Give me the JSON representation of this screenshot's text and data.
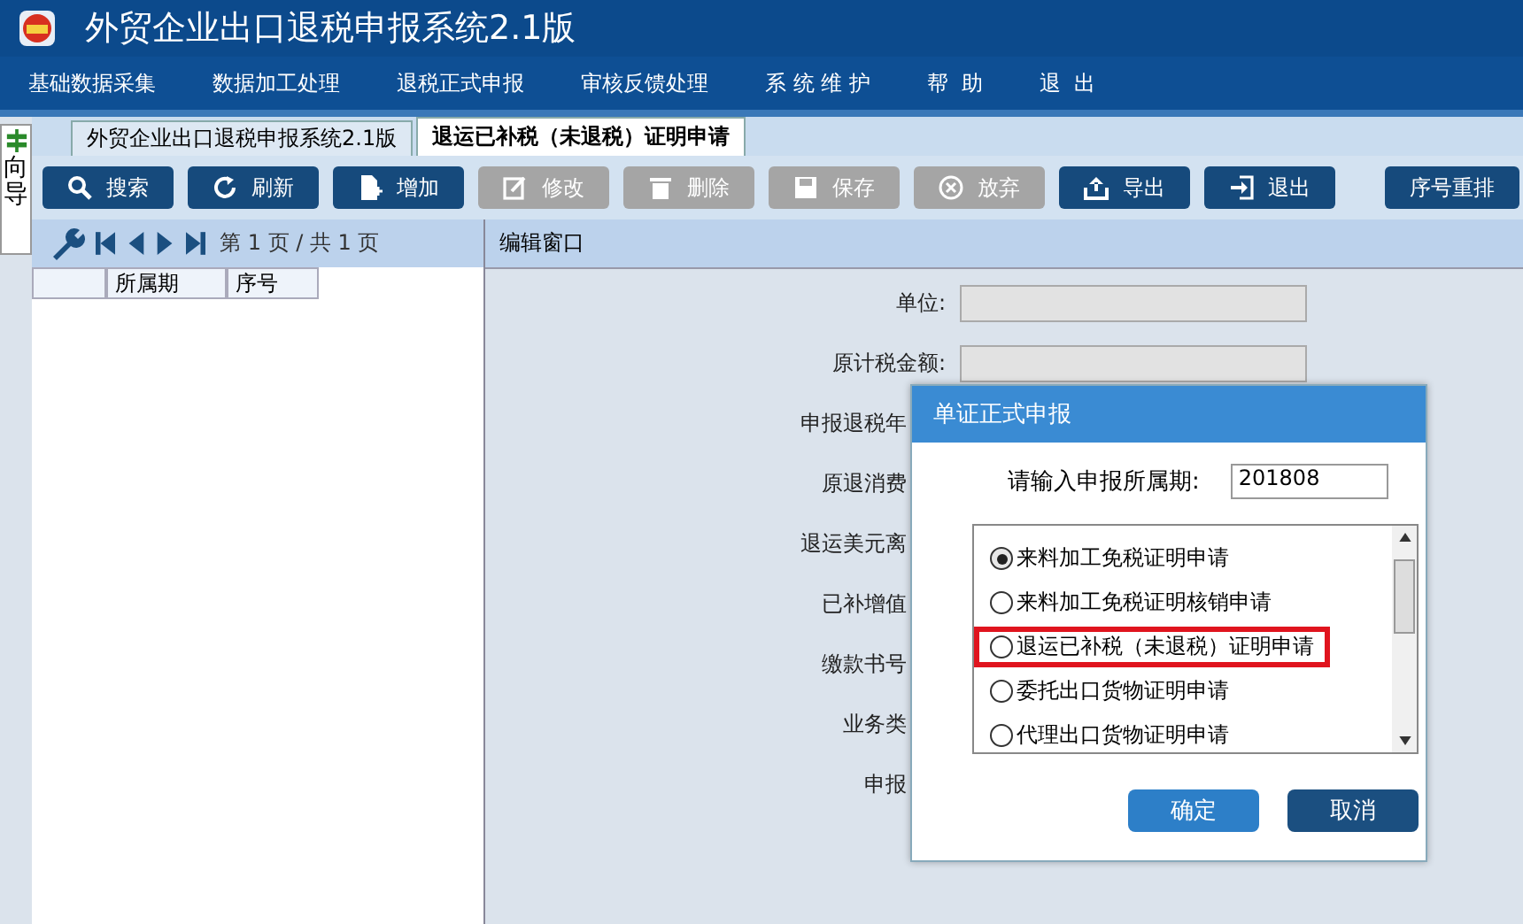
{
  "window": {
    "title": "外贸企业出口退税申报系统2.1版"
  },
  "menu": [
    "基础数据采集",
    "数据加工处理",
    "退税正式申报",
    "审核反馈处理",
    "系 统 维 护",
    "帮  助",
    "退  出"
  ],
  "side_tab": {
    "label": "向导"
  },
  "tabs": [
    {
      "label": "外贸企业出口退税申报系统2.1版",
      "selected": false
    },
    {
      "label": "退运已补税（未退税）证明申请",
      "selected": true
    }
  ],
  "toolbar": [
    {
      "label": "搜索",
      "kind": "search",
      "disabled": false
    },
    {
      "label": "刷新",
      "kind": "refresh",
      "disabled": false
    },
    {
      "label": "增加",
      "kind": "add",
      "disabled": false
    },
    {
      "label": "修改",
      "kind": "edit",
      "disabled": true
    },
    {
      "label": "删除",
      "kind": "delete",
      "disabled": true
    },
    {
      "label": "保存",
      "kind": "save",
      "disabled": true
    },
    {
      "label": "放弃",
      "kind": "cancel",
      "disabled": true
    },
    {
      "label": "导出",
      "kind": "export",
      "disabled": false
    },
    {
      "label": "退出",
      "kind": "exit",
      "disabled": false
    },
    {
      "label": "序号重排",
      "kind": "plain",
      "disabled": false
    }
  ],
  "pager": {
    "text": "第 1 页 / 共 1 页"
  },
  "table": {
    "columns": [
      "所属期",
      "序号"
    ]
  },
  "edit_panel": {
    "title": "编辑窗口",
    "fields": [
      {
        "label": "单位:",
        "has_input": true
      },
      {
        "label": "原计税金额:",
        "has_input": true
      },
      {
        "label": "申报退税年",
        "has_input": false
      },
      {
        "label": "原退消费",
        "has_input": false
      },
      {
        "label": "退运美元离",
        "has_input": false
      },
      {
        "label": "已补增值",
        "has_input": false
      },
      {
        "label": "缴款书号",
        "has_input": false
      },
      {
        "label": "业务类",
        "has_input": false
      },
      {
        "label": "申报",
        "has_input": false
      }
    ]
  },
  "dialog": {
    "title": "单证正式申报",
    "period_label": "请输入申报所属期:",
    "period_value": "201808",
    "options": [
      {
        "label": "来料加工免税证明申请",
        "selected": true,
        "highlighted": false
      },
      {
        "label": "来料加工免税证明核销申请",
        "selected": false,
        "highlighted": false
      },
      {
        "label": "退运已补税（未退税）证明申请",
        "selected": false,
        "highlighted": true
      },
      {
        "label": "委托出口货物证明申请",
        "selected": false,
        "highlighted": false
      },
      {
        "label": "代理出口货物证明申请",
        "selected": false,
        "highlighted": false
      }
    ],
    "buttons": [
      {
        "label": "确定",
        "kind": "primary"
      },
      {
        "label": "取消",
        "kind": "secondary"
      }
    ]
  }
}
